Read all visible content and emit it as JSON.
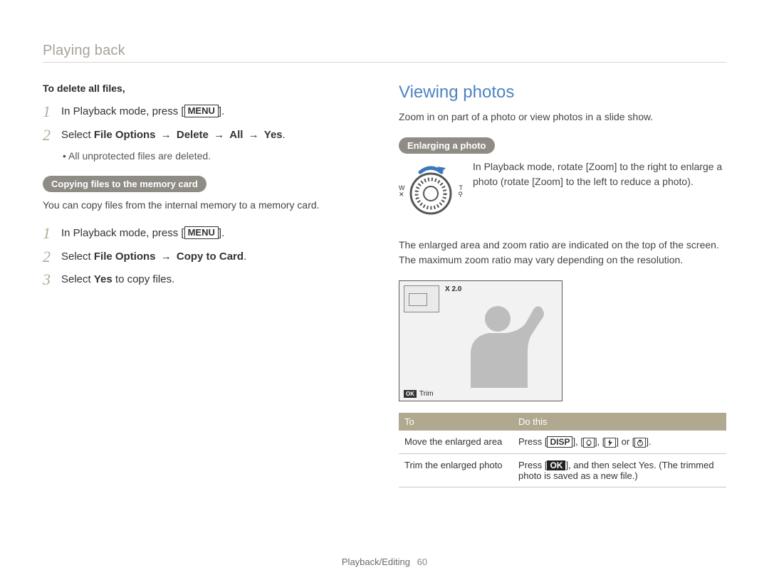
{
  "topic": "Playing back",
  "footer": {
    "section": "Playback/Editing",
    "page": "60"
  },
  "left": {
    "heading1": "To delete all files,",
    "step1_text": "In Playback mode, press [",
    "step1_btn": "MENU",
    "step1_tail": "].",
    "step2_prefix": "Select ",
    "step2_b1": "File Options",
    "step2_a1": " → ",
    "step2_b2": "Delete",
    "step2_a2": " → ",
    "step2_b3": "All",
    "step2_a3": " → ",
    "step2_b4": "Yes",
    "step2_tail": ".",
    "bullet1": "All unprotected files are deleted.",
    "pill1": "Copying files to the memory card",
    "desc1": "You can copy files from the internal memory to a memory card.",
    "stepA_text": "In Playback mode, press [",
    "stepA_btn": "MENU",
    "stepA_tail": "].",
    "stepB_prefix": "Select ",
    "stepB_b1": "File Options",
    "stepB_a1": " → ",
    "stepB_b2": "Copy to Card",
    "stepB_tail": ".",
    "stepC_prefix": "Select ",
    "stepC_b1": "Yes",
    "stepC_tail": " to copy files."
  },
  "right": {
    "title": "Viewing photos",
    "intro": "Zoom in on part of a photo or view photos in a slide show.",
    "pill": "Enlarging a photo",
    "dial_left_top": "W",
    "dial_left_bot": "✕",
    "dial_right_top": "T",
    "dial_right_bot": "⚲",
    "dial_text_1": "In Playback mode, rotate [",
    "dial_text_b1": "Zoom",
    "dial_text_2": "] to the right to enlarge a photo (rotate [",
    "dial_text_b2": "Zoom",
    "dial_text_3": "] to the left to reduce a photo).",
    "para2": "The enlarged area and zoom ratio are indicated on the top of the screen. The maximum zoom ratio may vary depending on the resolution.",
    "zoom_ratio": "X 2.0",
    "trim_ok": "OK",
    "trim_label": "Trim",
    "table": {
      "h1": "To",
      "h2": "Do this",
      "r1c1": "Move the enlarged area",
      "r1c2_prefix": "Press [",
      "r1c2_disp": "DISP",
      "r1c2_mid": "], [",
      "r1c2_sep": "], [",
      "r1c2_or": "] or [",
      "r1c2_tail": "].",
      "r2c1": "Trim the enlarged photo",
      "r2c2_prefix": "Press [",
      "r2c2_ok": "OK",
      "r2c2_mid": "], and then select ",
      "r2c2_yes": "Yes",
      "r2c2_tail": ". (The trimmed photo is saved as a new file.)"
    }
  }
}
